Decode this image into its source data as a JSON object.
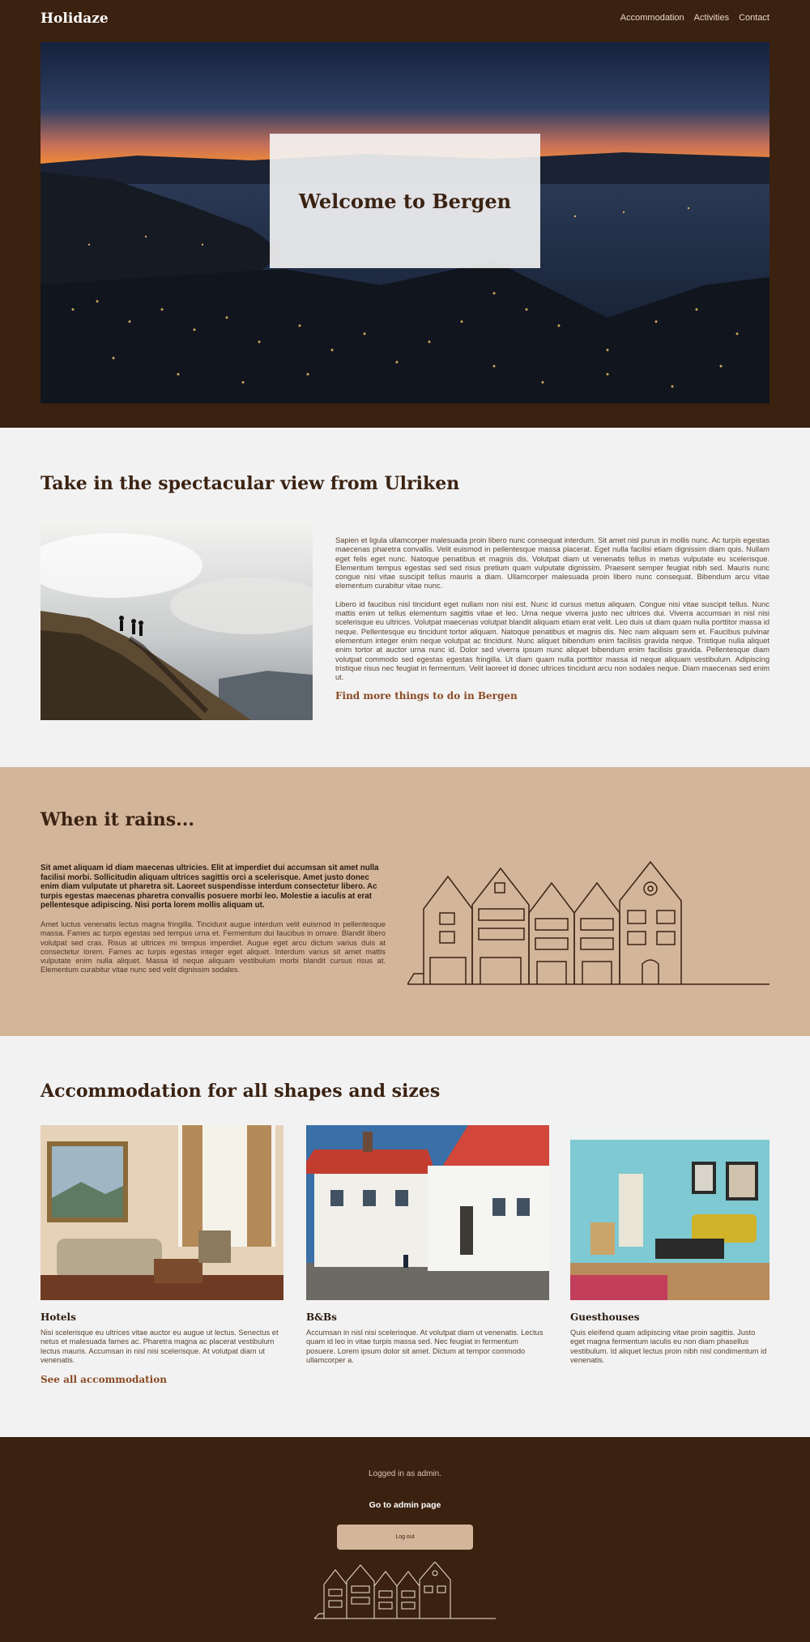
{
  "header": {
    "logo": "Holidaze",
    "nav": [
      "Accommodation",
      "Activities",
      "Contact"
    ]
  },
  "hero": {
    "title": "Welcome to Bergen"
  },
  "view_section": {
    "title": "Take in the spectacular view from Ulriken",
    "paragraph_1": "Sapien et ligula ullamcorper malesuada proin libero nunc consequat interdum. Sit amet nisl purus in mollis nunc. Ac turpis egestas maecenas pharetra convallis. Velit euismod in pellentesque massa placerat. Eget nulla facilisi etiam dignissim diam quis. Nullam eget felis eget nunc. Natoque penatibus et magnis dis. Volutpat diam ut venenatis tellus in metus vulputate eu scelerisque. Elementum tempus egestas sed sed risus pretium quam vulputate dignissim. Praesent semper feugiat nibh sed. Mauris nunc congue nisi vitae suscipit tellus mauris a diam. Ullamcorper malesuada proin libero nunc consequat. Bibendum arcu vitae elementum curabitur vitae nunc.",
    "paragraph_2": "Libero id faucibus nisl tincidunt eget nullam non nisi est. Nunc id cursus metus aliquam. Congue nisi vitae suscipit tellus. Nunc mattis enim ut tellus elementum sagittis vitae et leo. Urna neque viverra justo nec ultrices dui. Viverra accumsan in nisl nisi scelerisque eu ultrices. Volutpat maecenas volutpat blandit aliquam etiam erat velit. Leo duis ut diam quam nulla porttitor massa id neque. Pellentesque eu tincidunt tortor aliquam. Natoque penatibus et magnis dis. Nec nam aliquam sem et. Faucibus pulvinar elementum integer enim neque volutpat ac tincidunt. Nunc aliquet bibendum enim facilisis gravida neque. Tristique nulla aliquet enim tortor at auctor urna nunc id. Dolor sed viverra ipsum nunc aliquet bibendum enim facilisis gravida. Pellentesque diam volutpat commodo sed egestas egestas fringilla. Ut diam quam nulla porttitor massa id neque aliquam vestibulum. Adipiscing tristique risus nec feugiat in fermentum. Velit laoreet id donec ultrices tincidunt arcu non sodales neque. Diam maecenas sed enim ut.",
    "link": "Find more things to do in Bergen"
  },
  "rain_section": {
    "title": "When it rains...",
    "lead": "Sit amet aliquam id diam maecenas ultricies. Elit at imperdiet dui accumsan sit amet nulla facilisi morbi. Sollicitudin aliquam ultrices sagittis orci a scelerisque. Amet justo donec enim diam vulputate ut pharetra sit. Laoreet suspendisse interdum consectetur libero. Ac turpis egestas maecenas pharetra convallis posuere morbi leo. Molestie a iaculis at erat pellentesque adipiscing. Nisi porta lorem mollis aliquam ut.",
    "paragraph": "Amet luctus venenatis lectus magna fringilla. Tincidunt augue interdum velit euismod in pellentesque massa. Fames ac turpis egestas sed tempus urna et. Fermentum dui faucibus in ornare. Blandit libero volutpat sed cras. Risus at ultrices mi tempus imperdiet. Augue eget arcu dictum varius duis at consectetur lorem. Fames ac turpis egestas integer eget aliquet. Interdum varius sit amet mattis vulputate enim nulla aliquet. Massa id neque aliquam vestibulum morbi blandit cursus risus at. Elementum curabitur vitae nunc sed velit dignissim sodales."
  },
  "accommodation_section": {
    "title": "Accommodation for all shapes and sizes",
    "cards": [
      {
        "title": "Hotels",
        "text": "Nisi scelerisque eu ultrices vitae auctor eu augue ut lectus. Senectus et netus et malesuada fames ac. Pharetra magna ac placerat vestibulum lectus mauris. Accumsan in nisl nisi scelerisque. At volutpat diam ut venenatis.",
        "link": "See all accommodation"
      },
      {
        "title": "B&Bs",
        "text": "Accumsan in nisl nisi scelerisque. At volutpat diam ut venenatis. Lectus quam id leo in vitae turpis massa sed. Nec feugiat in fermentum posuere. Lorem ipsum dolor sit amet. Dictum at tempor commodo ullamcorper a."
      },
      {
        "title": "Guesthouses",
        "text": "Quis eleifend quam adipiscing vitae proin sagittis. Justo eget magna fermentum iaculis eu non diam phasellus vestibulum. Id aliquet lectus proin nibh nisl condimentum id venenatis."
      }
    ]
  },
  "footer": {
    "logged_in": "Logged in as admin.",
    "admin_link": "Go to admin page",
    "logout": "Log out"
  },
  "colors": {
    "dark_brown": "#3b2110",
    "tan": "#d3b59a",
    "light_bg": "#f2f2f2",
    "link_brown": "#8a4a23"
  }
}
